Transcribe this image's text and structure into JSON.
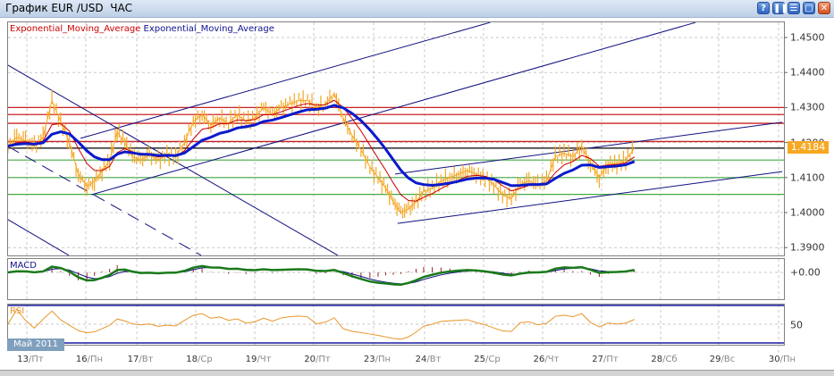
{
  "window": {
    "title": "График EUR /USD  ЧАС",
    "buttons": [
      {
        "name": "help-button",
        "glyph": "?"
      },
      {
        "name": "pause-button",
        "glyph": "❚❚"
      },
      {
        "name": "tile-button",
        "glyph": "☰"
      },
      {
        "name": "maximize-button",
        "glyph": "▢"
      },
      {
        "name": "close-button",
        "glyph": "✕"
      }
    ]
  },
  "legend": {
    "ema_fast": "Exponential_Moving_Average",
    "ema_slow": "Exponential_Moving_Average"
  },
  "colors": {
    "price": "#f5a623",
    "ema_fast": "#cc0000",
    "ema_slow": "#0a1acc",
    "resistance": "#cc2222",
    "support": "#44aa44",
    "trendline": "#101080",
    "current": "#000000",
    "macd": "#1a7a1a",
    "macd_signal": "#101080",
    "rsi": "#e8962a"
  },
  "current_price": "1.4184",
  "month_label": "Май 2011",
  "macd_label": "MACD",
  "macd_zero_label": "+0.00",
  "rsi_label": "RSI",
  "rsi_mid_label": "50",
  "chart_data": {
    "type": "line",
    "title": "График EUR /USD  ЧАС",
    "y_ticks": [
      "1.4500",
      "1.4400",
      "1.4300",
      "1.4200",
      "1.4100",
      "1.4000",
      "1.3900"
    ],
    "ylim": [
      1.3878,
      1.4545
    ],
    "x_ticks": [
      {
        "day": "13",
        "wd": "Пт"
      },
      {
        "day": "16",
        "wd": "Пн"
      },
      {
        "day": "17",
        "wd": "Вт"
      },
      {
        "day": "18",
        "wd": "Ср"
      },
      {
        "day": "19",
        "wd": "Чт"
      },
      {
        "day": "20",
        "wd": "Пт"
      },
      {
        "day": "23",
        "wd": "Пн"
      },
      {
        "day": "24",
        "wd": "Вт"
      },
      {
        "day": "25",
        "wd": "Ср"
      },
      {
        "day": "26",
        "wd": "Чт"
      },
      {
        "day": "27",
        "wd": "Пт"
      },
      {
        "day": "28",
        "wd": "Сб"
      },
      {
        "day": "29",
        "wd": "Вс"
      },
      {
        "day": "30",
        "wd": "Пн"
      }
    ],
    "price_start_tick": -0.32,
    "price_step_ticks": 0.149,
    "close": [
      1.419,
      1.4215,
      1.4205,
      1.419,
      1.4215,
      1.432,
      1.426,
      1.42,
      1.411,
      1.4075,
      1.409,
      1.412,
      1.415,
      1.423,
      1.42,
      1.416,
      1.415,
      1.4165,
      1.415,
      1.4165,
      1.416,
      1.42,
      1.426,
      1.428,
      1.425,
      1.427,
      1.4255,
      1.428,
      1.426,
      1.427,
      1.43,
      1.428,
      1.43,
      1.431,
      1.432,
      1.432,
      1.43,
      1.431,
      1.434,
      1.427,
      1.422,
      1.418,
      1.413,
      1.41,
      1.407,
      1.403,
      1.4,
      1.401,
      1.403,
      1.406,
      1.407,
      1.409,
      1.41,
      1.411,
      1.412,
      1.411,
      1.41,
      1.408,
      1.405,
      1.404,
      1.408,
      1.409,
      1.408,
      1.409,
      1.416,
      1.417,
      1.416,
      1.419,
      1.414,
      1.41,
      1.414,
      1.414,
      1.415,
      1.4184
    ],
    "resistance_levels": [
      1.43,
      1.428,
      1.4255,
      1.4203
    ],
    "support_levels": [
      1.415,
      1.41,
      1.4052
    ],
    "current_level": 1.4184,
    "trendlines": [
      {
        "from": [
          -0.32,
          1.4421
        ],
        "to": [
          5.4,
          1.3878
        ],
        "dashed": false
      },
      {
        "from": [
          -0.32,
          1.4189
        ],
        "to": [
          3.09,
          1.3878
        ],
        "dashed": true
      },
      {
        "from": [
          -0.32,
          1.398
        ],
        "to": [
          0.71,
          1.3878
        ],
        "dashed": false
      },
      {
        "from": [
          0.91,
          1.4212
        ],
        "to": [
          8.11,
          1.4543
        ],
        "dashed": false
      },
      {
        "from": [
          1.11,
          1.4051
        ],
        "to": [
          11.6,
          1.4543
        ],
        "dashed": false
      },
      {
        "from": [
          6.42,
          1.411
        ],
        "to": [
          13.06,
          1.4258
        ],
        "dashed": false
      },
      {
        "from": [
          6.47,
          1.3969
        ],
        "to": [
          13.06,
          1.4117
        ],
        "dashed": false
      }
    ]
  }
}
